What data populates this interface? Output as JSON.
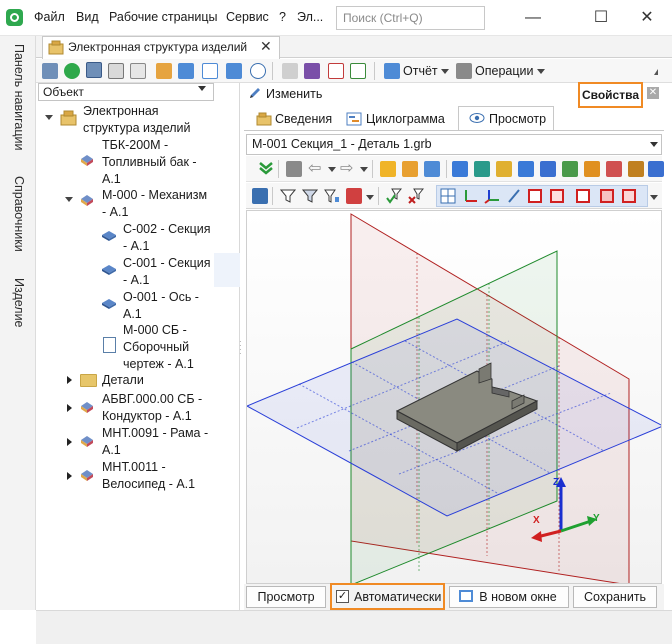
{
  "menu": {
    "items": [
      "Файл",
      "Вид",
      "Рабочие страницы",
      "Сервис",
      "?",
      "Эл..."
    ],
    "search_placeholder": "Поиск (Ctrl+Q)"
  },
  "window_controls": {
    "minimize": "—",
    "maximize": "☐",
    "close": "✕"
  },
  "vertical_tabs": [
    "Панель навигации",
    "Справочники",
    "Изделие"
  ],
  "document_tab": {
    "title": "Электронная структура изделий",
    "close": "✕"
  },
  "main_toolbar": {
    "report_label": "Отчёт",
    "operations_label": "Операции"
  },
  "tree": {
    "combo_value": "Объект",
    "root": {
      "line1": "Электронная",
      "line2": "структура изделий"
    },
    "items": [
      {
        "line1": "ТБК-200М -",
        "line2": "Топливный бак -",
        "line3": "А.1",
        "icon": "assembly-icon"
      },
      {
        "line1": "М-000 - Механизм",
        "line2": "- А.1",
        "icon": "assembly-icon"
      },
      {
        "line1": "С-002 - Секция",
        "line2": "- А.1",
        "icon": "part-icon"
      },
      {
        "line1": "С-001 - Секция",
        "line2": "- А.1",
        "icon": "part-icon"
      },
      {
        "line1": "О-001 - Ось -",
        "line2": "А.1",
        "icon": "part-icon"
      },
      {
        "line1": "М-000 СБ -",
        "line2": "Сборочный",
        "line3": "чертеж - А.1",
        "icon": "drawing-icon"
      },
      {
        "line1": "Детали",
        "icon": "folder-icon"
      },
      {
        "line1": "АБВГ.000.00 СБ -",
        "line2": "Кондуктор - А.1",
        "icon": "assembly-icon"
      },
      {
        "line1": "МНТ.0091 - Рама -",
        "line2": "А.1",
        "icon": "assembly-icon"
      },
      {
        "line1": "МНТ.0011 -",
        "line2": "Велосипед - А.1",
        "icon": "assembly-icon"
      }
    ]
  },
  "right_panel": {
    "edit_label": "Изменить",
    "properties_label": "Свойства",
    "properties_close": "✕",
    "tabs": [
      "Сведения",
      "Циклограмма",
      "Просмотр"
    ],
    "active_tab": "Просмотр",
    "file_value": "М-001 Секция_1 - Деталь 1.grb",
    "axes": {
      "x": "X",
      "y": "Y",
      "z": "Z"
    },
    "buttons": {
      "preview": "Просмотр",
      "auto_check": "✓",
      "auto": "Автоматически",
      "new_window": "В новом окне",
      "save": "Сохранить"
    }
  },
  "colors": {
    "accent_orange": "#f08a24",
    "plane_red": "#b02020",
    "plane_green": "#1f8a2c",
    "plane_blue": "#2a3fd8",
    "logo_green": "#2fa84f"
  }
}
